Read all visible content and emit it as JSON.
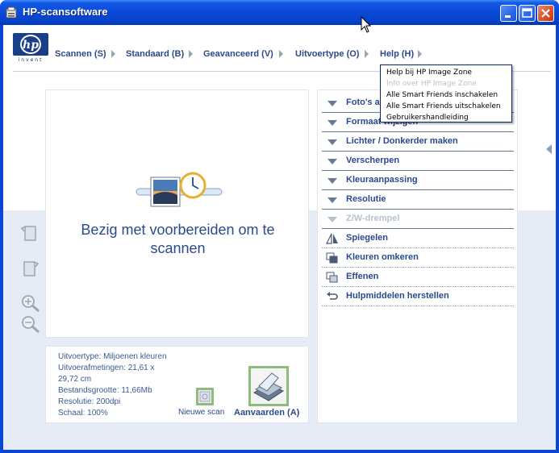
{
  "window": {
    "title": "HP-scansoftware"
  },
  "logo": {
    "brand": "hp",
    "tagline": "invent"
  },
  "menu": [
    {
      "label": "Scannen (S)"
    },
    {
      "label": "Standaard (B)"
    },
    {
      "label": "Geavanceerd (V)"
    },
    {
      "label": "Uitvoertype (O)"
    },
    {
      "label": "Help (H)"
    }
  ],
  "help_menu": {
    "items": [
      {
        "label": "Help bij HP Image Zone",
        "enabled": true
      },
      {
        "label": "Info over HP Image Zone",
        "enabled": false
      },
      {
        "label": "Alle Smart Friends inschakelen",
        "enabled": true
      },
      {
        "label": "Alle Smart Friends uitschakelen",
        "enabled": true
      },
      {
        "label": "Gebruikershandleiding",
        "enabled": true
      }
    ]
  },
  "preview": {
    "status_line1": "Bezig met voorbereiden om te",
    "status_line2": "scannen"
  },
  "info": {
    "output_type": "Uitvoertype: Miljoenen kleuren",
    "dimensions_line1": "Uitvoerafmetingen: 21,61 x",
    "dimensions_line2": "29,72 cm",
    "file_size": "Bestandsgrootte: 11,66Mb",
    "resolution": "Resolutie:  200dpi",
    "scale": "Schaal: 100%",
    "new_scan_label": "Nieuwe scan",
    "accept_label": "Aanvaarden (A)"
  },
  "options": [
    {
      "label": "Foto's a",
      "kind": "expand",
      "enabled": true
    },
    {
      "label": "Formaat wijzigen",
      "kind": "expand",
      "enabled": true
    },
    {
      "label": "Lichter / Donkerder maken",
      "kind": "expand",
      "enabled": true
    },
    {
      "label": "Verscherpen",
      "kind": "expand",
      "enabled": true
    },
    {
      "label": "Kleuraanpassing",
      "kind": "expand",
      "enabled": true
    },
    {
      "label": "Resolutie",
      "kind": "expand",
      "enabled": true
    },
    {
      "label": "Z/W-drempel",
      "kind": "expand",
      "enabled": false
    },
    {
      "label": "Spiegelen",
      "kind": "action",
      "icon": "mirror-icon",
      "enabled": true
    },
    {
      "label": "Kleuren omkeren",
      "kind": "action",
      "icon": "invert-colors-icon",
      "enabled": true
    },
    {
      "label": "Effenen",
      "kind": "action",
      "icon": "smooth-icon",
      "enabled": true
    },
    {
      "label": "Hulpmiddelen herstellen",
      "kind": "action",
      "icon": "undo-icon",
      "enabled": true
    }
  ],
  "colors": {
    "titlebar": "#0a46d6",
    "menu_text": "#2a4a8c",
    "accent_green": "#8ebc7a"
  }
}
